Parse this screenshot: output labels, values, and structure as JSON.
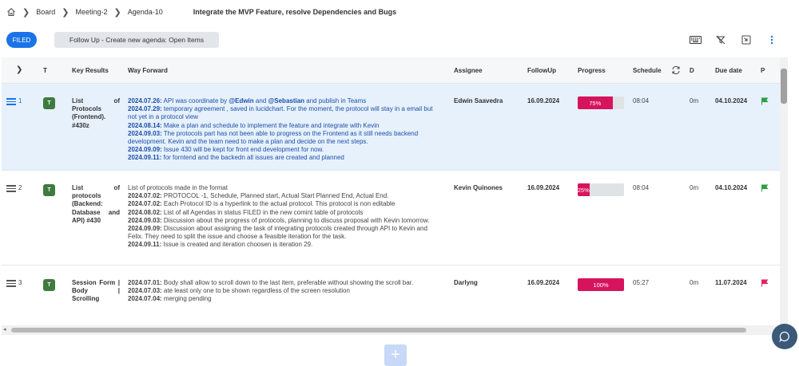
{
  "breadcrumb": {
    "items": [
      "Board",
      "Meeting-2",
      "Agenda-10"
    ],
    "title": "Integrate the MVP Feature, resolve Dependencies and Bugs"
  },
  "toolbar": {
    "filed_label": "FILED",
    "followup_label": "Follow Up - Create new agenda: Open Items"
  },
  "table": {
    "headers": {
      "type": "T",
      "key_results": "Key Results",
      "way_forward": "Way Forward",
      "assignee": "Assignee",
      "followup": "FollowUp",
      "progress": "Progress",
      "schedule": "Schedule",
      "d": "D",
      "due": "Due date",
      "p": "P"
    },
    "rows": [
      {
        "num": "1",
        "type": "T",
        "key_result": "List of Protocols (Frontend). #430z",
        "way_forward": [
          {
            "date": "2024.07.26:",
            "text": " API was coordinate by ",
            "b1": "@Edwin",
            "mid": " and ",
            "b2": "@Sebastian",
            "end": " and publish in Teams"
          },
          {
            "date": "2024.07.29:",
            "text": " temporary agreement , saved in lucidchart. For the moment, the protocol will stay in a email but not yet in a protocol view"
          },
          {
            "date": "2024.08.14:",
            "text": " Make a plan and schedule to implement the feature and integrate with Kevin"
          },
          {
            "date": "2024.09.03:",
            "text": " The protocols part has not been able to progress on the Frontend as it still needs backend development. Kevin and the team need to make a plan and decide on the next steps."
          },
          {
            "date": "2024.09.09:",
            "text": " Issue 430 will be kept for front end development for now."
          },
          {
            "date": "2024.09.11:",
            "text": " for forntend and the backedn all issues are created and planned"
          }
        ],
        "assignee": "Edwin Saavedra",
        "followup": "16.09.2024",
        "progress_label": "75%",
        "progress_value": 75,
        "schedule": "08:04",
        "d": "0m",
        "due": "04.10.2024",
        "flag_color": "#2e9e44"
      },
      {
        "num": "2",
        "type": "T",
        "key_result": "List of protocols (Backend: Database and API) #430",
        "way_forward_intro": "List of protocols made in the format",
        "way_forward": [
          {
            "date": "2024.07.02:",
            "text": " PROTOCOL -1, Schedule, Planned start, Actual Start Planned End, Actual End."
          },
          {
            "date": "2024.07.02:",
            "text": " Each Protocol ID is a hyperlink to the actual protocol. This protocol is non editable"
          },
          {
            "date": "2024.08.02:",
            "text": " List of all Agendas in status FILED in the new comint table of protocols"
          },
          {
            "date": "2024.09.03:",
            "text": " Discussion about the progress of protocols, planning to discuss proposal with Kevin tomorrow."
          },
          {
            "date": "2024.09.09:",
            "text": " Discussion about assigning the task of integrating protocols created through API to Kevin and Felix. They need to split the issue and choose a feasible iteration for the task."
          },
          {
            "date": "2024.09.11:",
            "text": " Issue is created and iteration choosen is iteration 29."
          }
        ],
        "assignee": "Kevin Quinones",
        "followup": "16.09.2024",
        "progress_label": "25%",
        "progress_value": 25,
        "schedule": "08:04",
        "d": "0m",
        "due": "04.10.2024",
        "flag_color": "#2e9e44"
      },
      {
        "num": "3",
        "type": "T",
        "key_result": "Session Form | Body | Scrolling",
        "way_forward": [
          {
            "date": "2024.07.01:",
            "text": " Body shall allow to scroll down to the last item, preferable without showing the scroll bar."
          },
          {
            "date": "2024.07.03:",
            "text": " ate least only one to be shown regardless of the screen resolution"
          },
          {
            "date": "2024.07.04:",
            "text": " merging pending"
          }
        ],
        "assignee": "Darlyng",
        "followup": "16.09.2024",
        "progress_label": "100%",
        "progress_value": 100,
        "schedule": "05:27",
        "d": "0m",
        "due": "11.07.2024",
        "flag_color": "#e0245e"
      }
    ]
  },
  "colors": {
    "accent": "#1a73e8",
    "progress": "#d6145e",
    "badge": "#3f7a3f"
  },
  "icons": [
    "home-icon",
    "keyboard-icon",
    "filter-off-icon",
    "exit-fullscreen-icon",
    "more-vertical-icon",
    "refresh-icon",
    "chat-icon",
    "plus-icon"
  ]
}
